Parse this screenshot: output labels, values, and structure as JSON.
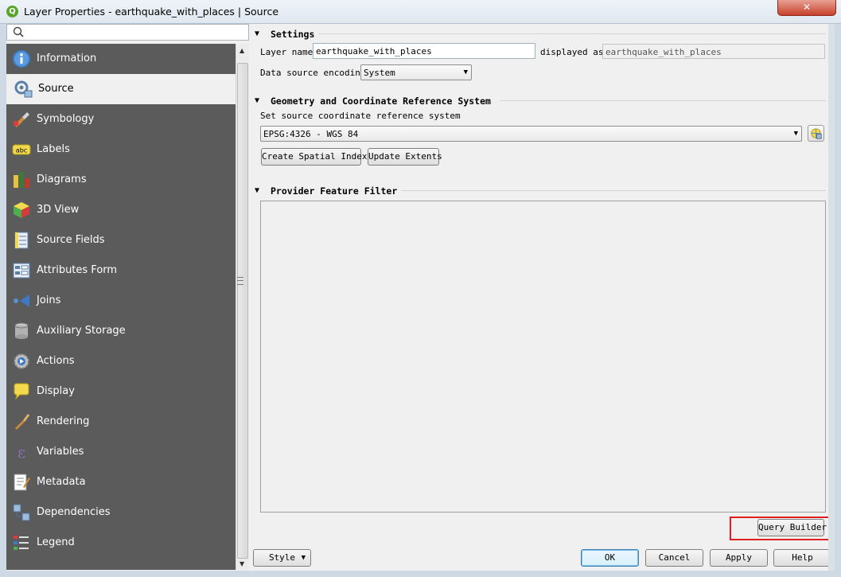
{
  "window": {
    "title": "Layer Properties - earthquake_with_places | Source",
    "app_icon": "qgis-icon",
    "close_label": "✕"
  },
  "sidebar": {
    "search_placeholder": "",
    "items": [
      {
        "label": "Information",
        "icon": "information-icon"
      },
      {
        "label": "Source",
        "icon": "source-icon",
        "selected": true
      },
      {
        "label": "Symbology",
        "icon": "symbology-icon"
      },
      {
        "label": "Labels",
        "icon": "labels-icon"
      },
      {
        "label": "Diagrams",
        "icon": "diagrams-icon"
      },
      {
        "label": "3D View",
        "icon": "3d-view-icon"
      },
      {
        "label": "Source Fields",
        "icon": "source-fields-icon"
      },
      {
        "label": "Attributes Form",
        "icon": "attributes-form-icon"
      },
      {
        "label": "Joins",
        "icon": "joins-icon"
      },
      {
        "label": "Auxiliary Storage",
        "icon": "auxiliary-storage-icon"
      },
      {
        "label": "Actions",
        "icon": "actions-icon"
      },
      {
        "label": "Display",
        "icon": "display-icon"
      },
      {
        "label": "Rendering",
        "icon": "rendering-icon"
      },
      {
        "label": "Variables",
        "icon": "variables-icon"
      },
      {
        "label": "Metadata",
        "icon": "metadata-icon"
      },
      {
        "label": "Dependencies",
        "icon": "dependencies-icon"
      },
      {
        "label": "Legend",
        "icon": "legend-icon"
      }
    ]
  },
  "settings": {
    "header": "Settings",
    "layer_name_label": "Layer name",
    "layer_name_value": "earthquake_with_places",
    "displayed_as_label": "displayed as",
    "displayed_as_value": "earthquake_with_places",
    "encoding_label": "Data source encoding",
    "encoding_value": "System"
  },
  "geometry": {
    "header": "Geometry and Coordinate Reference System",
    "crs_label": "Set source coordinate reference system",
    "crs_value": "EPSG:4326 - WGS 84",
    "create_index_button": "Create Spatial Index",
    "update_extents_button": "Update Extents"
  },
  "filter": {
    "header": "Provider Feature Filter",
    "text": "",
    "query_builder_button": "Query Builder"
  },
  "footer": {
    "style_button": "Style",
    "ok_button": "OK",
    "cancel_button": "Cancel",
    "apply_button": "Apply",
    "help_button": "Help"
  },
  "colors": {
    "sidebar_bg": "#5b5b5b",
    "highlight_border": "#e02020"
  }
}
